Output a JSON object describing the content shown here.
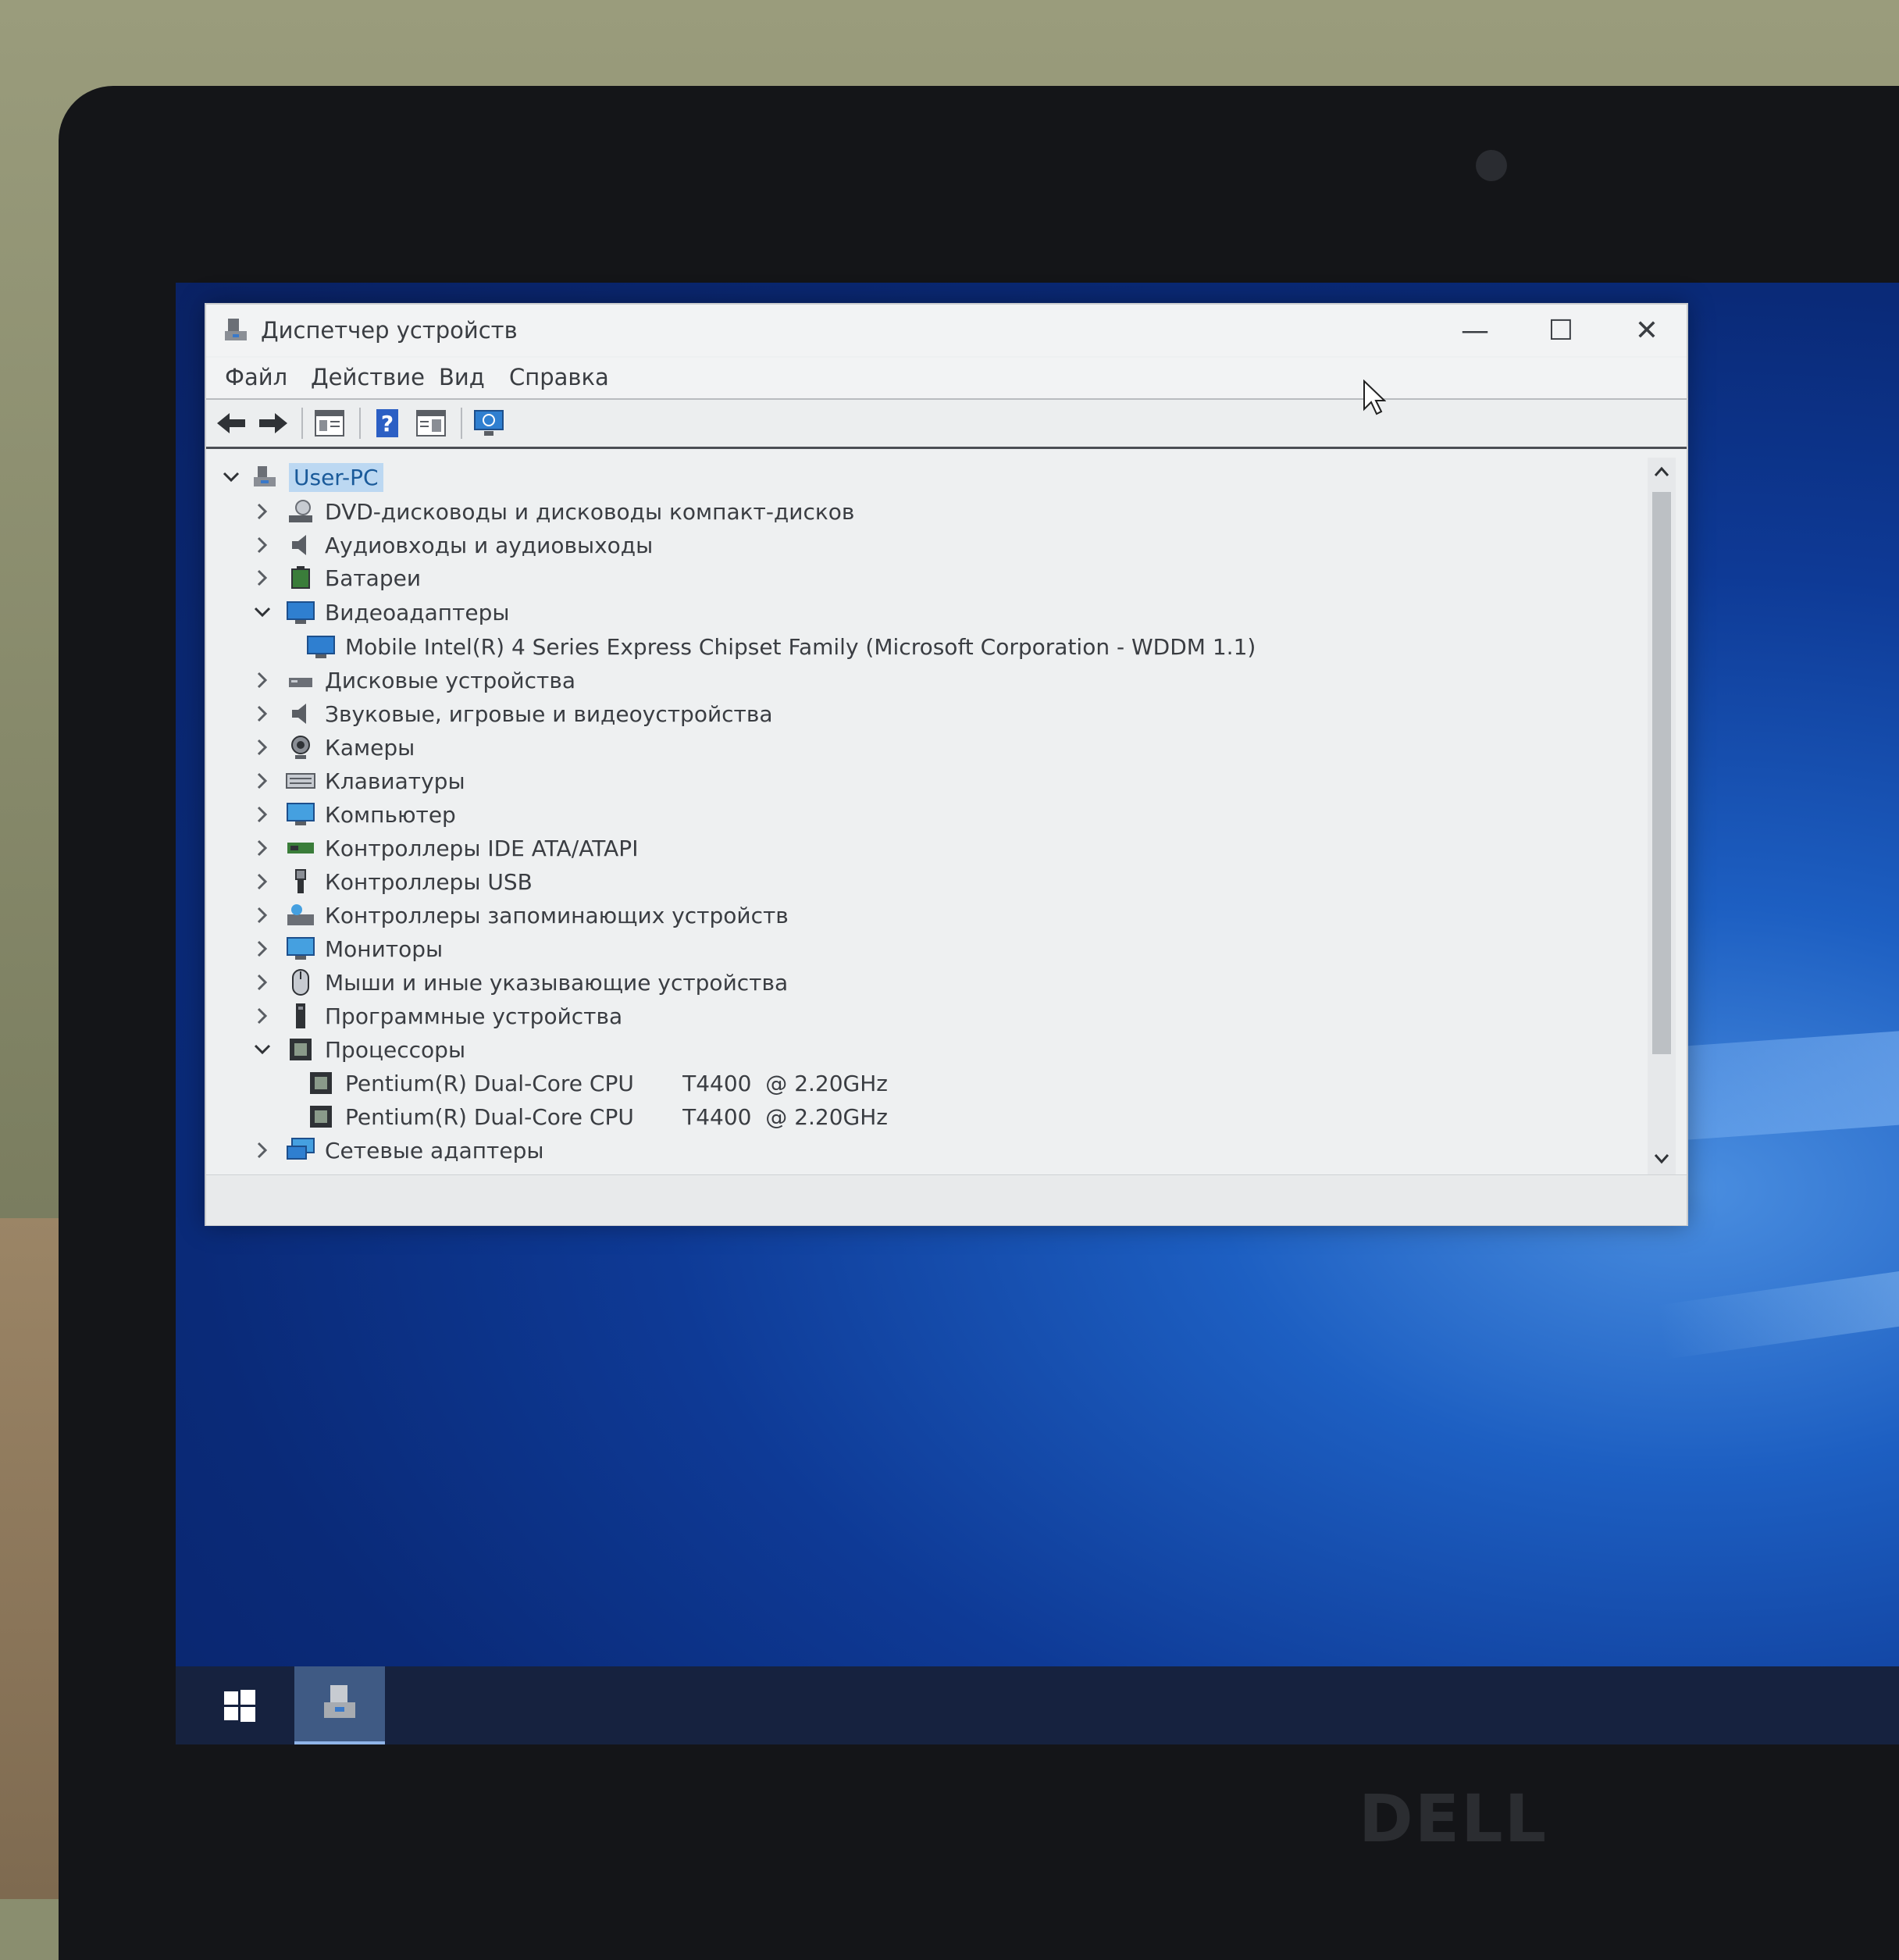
{
  "window": {
    "title": "Диспетчер устройств",
    "controls": {
      "minimize": "—",
      "maximize": "☐",
      "close": "✕"
    }
  },
  "menu": [
    "Файл",
    "Действие",
    "Вид",
    "Справка"
  ],
  "toolbar": {
    "icons": [
      "back-arrow-icon",
      "forward-arrow-icon",
      "properties-icon",
      "help-icon",
      "view-icon",
      "scan-hardware-icon"
    ]
  },
  "tree": {
    "root": "User-PC",
    "items": [
      {
        "label": "DVD-дисководы и дисководы компакт-дисков",
        "expanded": false,
        "icon": "dvd-drive-icon"
      },
      {
        "label": "Аудиовходы и аудиовыходы",
        "expanded": false,
        "icon": "speaker-icon"
      },
      {
        "label": "Батареи",
        "expanded": false,
        "icon": "battery-icon"
      },
      {
        "label": "Видеоадаптеры",
        "expanded": true,
        "icon": "display-adapter-icon",
        "children": [
          "Mobile Intel(R) 4 Series Express Chipset Family (Microsoft Corporation - WDDM 1.1)"
        ]
      },
      {
        "label": "Дисковые устройства",
        "expanded": false,
        "icon": "disk-drive-icon"
      },
      {
        "label": "Звуковые, игровые и видеоустройства",
        "expanded": false,
        "icon": "sound-icon"
      },
      {
        "label": "Камеры",
        "expanded": false,
        "icon": "camera-icon"
      },
      {
        "label": "Клавиатуры",
        "expanded": false,
        "icon": "keyboard-icon"
      },
      {
        "label": "Компьютер",
        "expanded": false,
        "icon": "computer-icon"
      },
      {
        "label": "Контроллеры IDE ATA/ATAPI",
        "expanded": false,
        "icon": "ide-controller-icon"
      },
      {
        "label": "Контроллеры USB",
        "expanded": false,
        "icon": "usb-icon"
      },
      {
        "label": "Контроллеры запоминающих устройств",
        "expanded": false,
        "icon": "storage-controller-icon"
      },
      {
        "label": "Мониторы",
        "expanded": false,
        "icon": "monitor-icon"
      },
      {
        "label": "Мыши и иные указывающие устройства",
        "expanded": false,
        "icon": "mouse-icon"
      },
      {
        "label": "Программные устройства",
        "expanded": false,
        "icon": "software-device-icon"
      },
      {
        "label": "Процессоры",
        "expanded": true,
        "icon": "processor-icon",
        "children": [
          "Pentium(R) Dual-Core CPU       T4400  @ 2.20GHz",
          "Pentium(R) Dual-Core CPU       T4400  @ 2.20GHz"
        ]
      },
      {
        "label": "Сетевые адаптеры",
        "expanded": false,
        "icon": "network-adapter-icon"
      }
    ]
  },
  "taskbar": {
    "start": "windows-start-icon",
    "apps": [
      "device-manager-icon"
    ]
  },
  "laptop": {
    "brand": "DELL"
  }
}
